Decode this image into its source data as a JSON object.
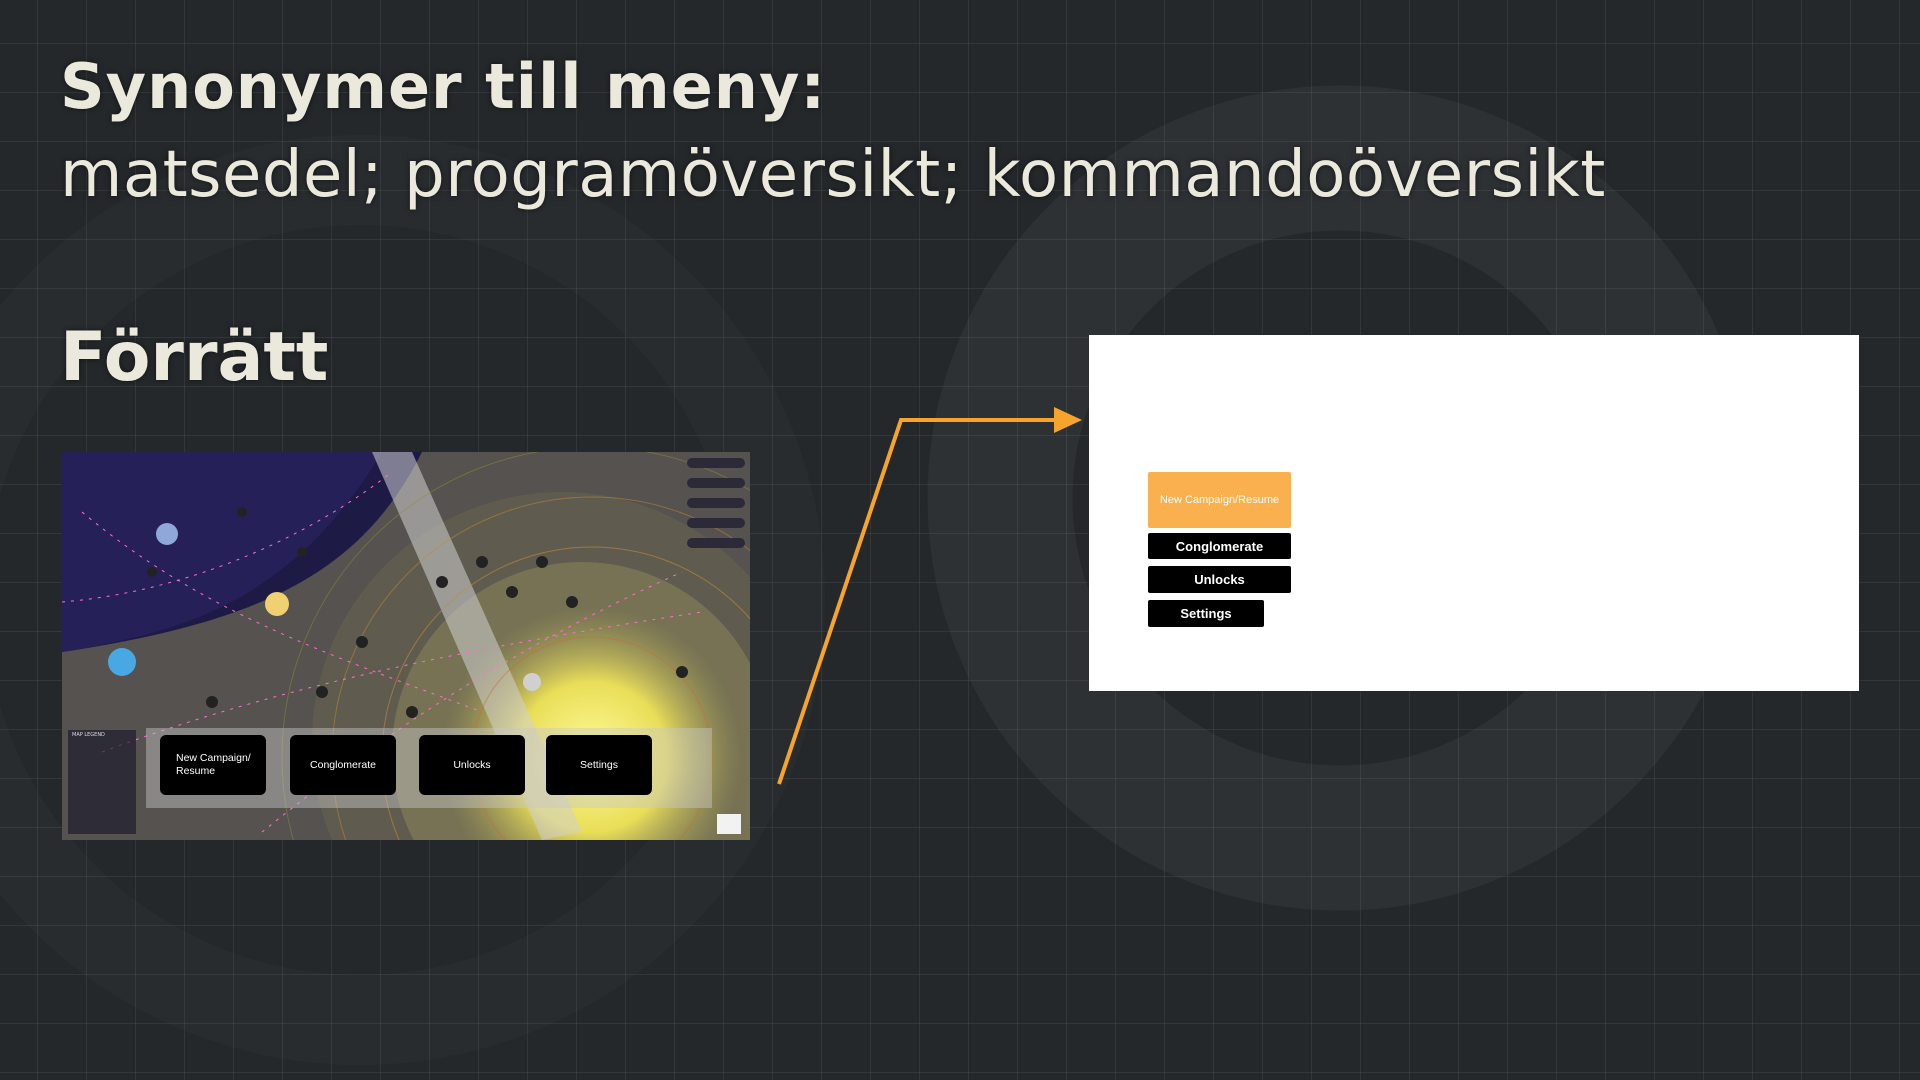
{
  "slide": {
    "heading_bold": "Synonymer till meny:",
    "heading_synonyms": "matsedel; programöversikt; kommandoöversikt",
    "section_title": "Förrätt"
  },
  "game_screenshot": {
    "legend_heading": "MAP LEGEND",
    "menu_buttons": [
      "New Campaign/\nResume",
      "Conglomerate",
      "Unlocks",
      "Settings"
    ]
  },
  "wireframe": {
    "buttons": [
      "New Campaign/Resume",
      "Conglomerate",
      "Unlocks",
      "Settings"
    ]
  },
  "colors": {
    "background": "#25282b",
    "text": "#ebe8dc",
    "accent_orange": "#f6a42c",
    "wireframe_button_highlight": "#fbb04f"
  },
  "icons": [
    "arrow-right-icon"
  ]
}
